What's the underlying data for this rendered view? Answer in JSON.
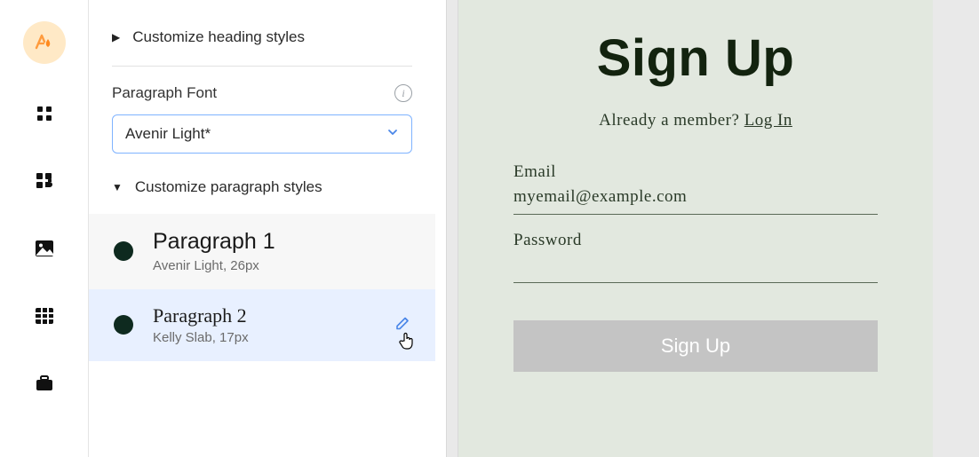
{
  "rail": {
    "brand_icon": "font-drop-icon",
    "icons": [
      "grid-icon",
      "puzzle-icon",
      "image-icon",
      "table-icon",
      "briefcase-icon"
    ]
  },
  "panel": {
    "heading_accordion": "Customize heading styles",
    "paragraph_font_label": "Paragraph Font",
    "paragraph_font_value": "Avenir Light*",
    "paragraph_accordion": "Customize paragraph styles",
    "paragraphs": [
      {
        "title": "Paragraph 1",
        "sub": "Avenir Light, 26px"
      },
      {
        "title": "Paragraph 2",
        "sub": "Kelly Slab, 17px"
      }
    ]
  },
  "preview": {
    "title": "Sign Up",
    "already_text": "Already a member? ",
    "login_text": "Log In",
    "email_label": "Email",
    "email_value": "myemail@example.com",
    "password_label": "Password",
    "button_label": "Sign Up"
  }
}
